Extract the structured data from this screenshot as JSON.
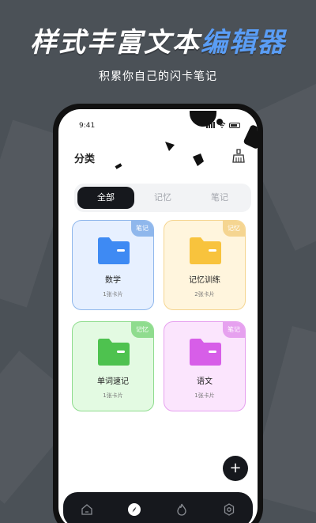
{
  "promo": {
    "headline_main": "样式丰富文本",
    "headline_accent": "编辑器",
    "subline": "积累你自己的闪卡笔记"
  },
  "status_bar": {
    "time": "9:41"
  },
  "page": {
    "title": "分类"
  },
  "tabs": [
    {
      "label": "全部",
      "active": true
    },
    {
      "label": "记忆",
      "active": false
    },
    {
      "label": "笔记",
      "active": false
    }
  ],
  "cards": [
    {
      "name": "数学",
      "count": "1张卡片",
      "tag": "笔记",
      "bg": "#e7f0ff",
      "border": "#8fb7ec",
      "tag_color": "#8fb7ec",
      "folder": "#3e8af3"
    },
    {
      "name": "记忆训练",
      "count": "2张卡片",
      "tag": "记忆",
      "bg": "#fff5dd",
      "border": "#f5d591",
      "tag_color": "#f5d591",
      "folder": "#f8c33d"
    },
    {
      "name": "单词速记",
      "count": "1张卡片",
      "tag": "记忆",
      "bg": "#e3fae2",
      "border": "#8fdc8e",
      "tag_color": "#8fdc8e",
      "folder": "#4ec24f"
    },
    {
      "name": "语文",
      "count": "1张卡片",
      "tag": "笔记",
      "bg": "#fbe5fd",
      "border": "#e6a1ef",
      "tag_color": "#e6a1ef",
      "folder": "#d75ee8"
    }
  ],
  "fab": {
    "label": "+"
  },
  "bottom_nav": [
    "home-icon",
    "compass-icon",
    "fire-icon",
    "settings-icon"
  ]
}
